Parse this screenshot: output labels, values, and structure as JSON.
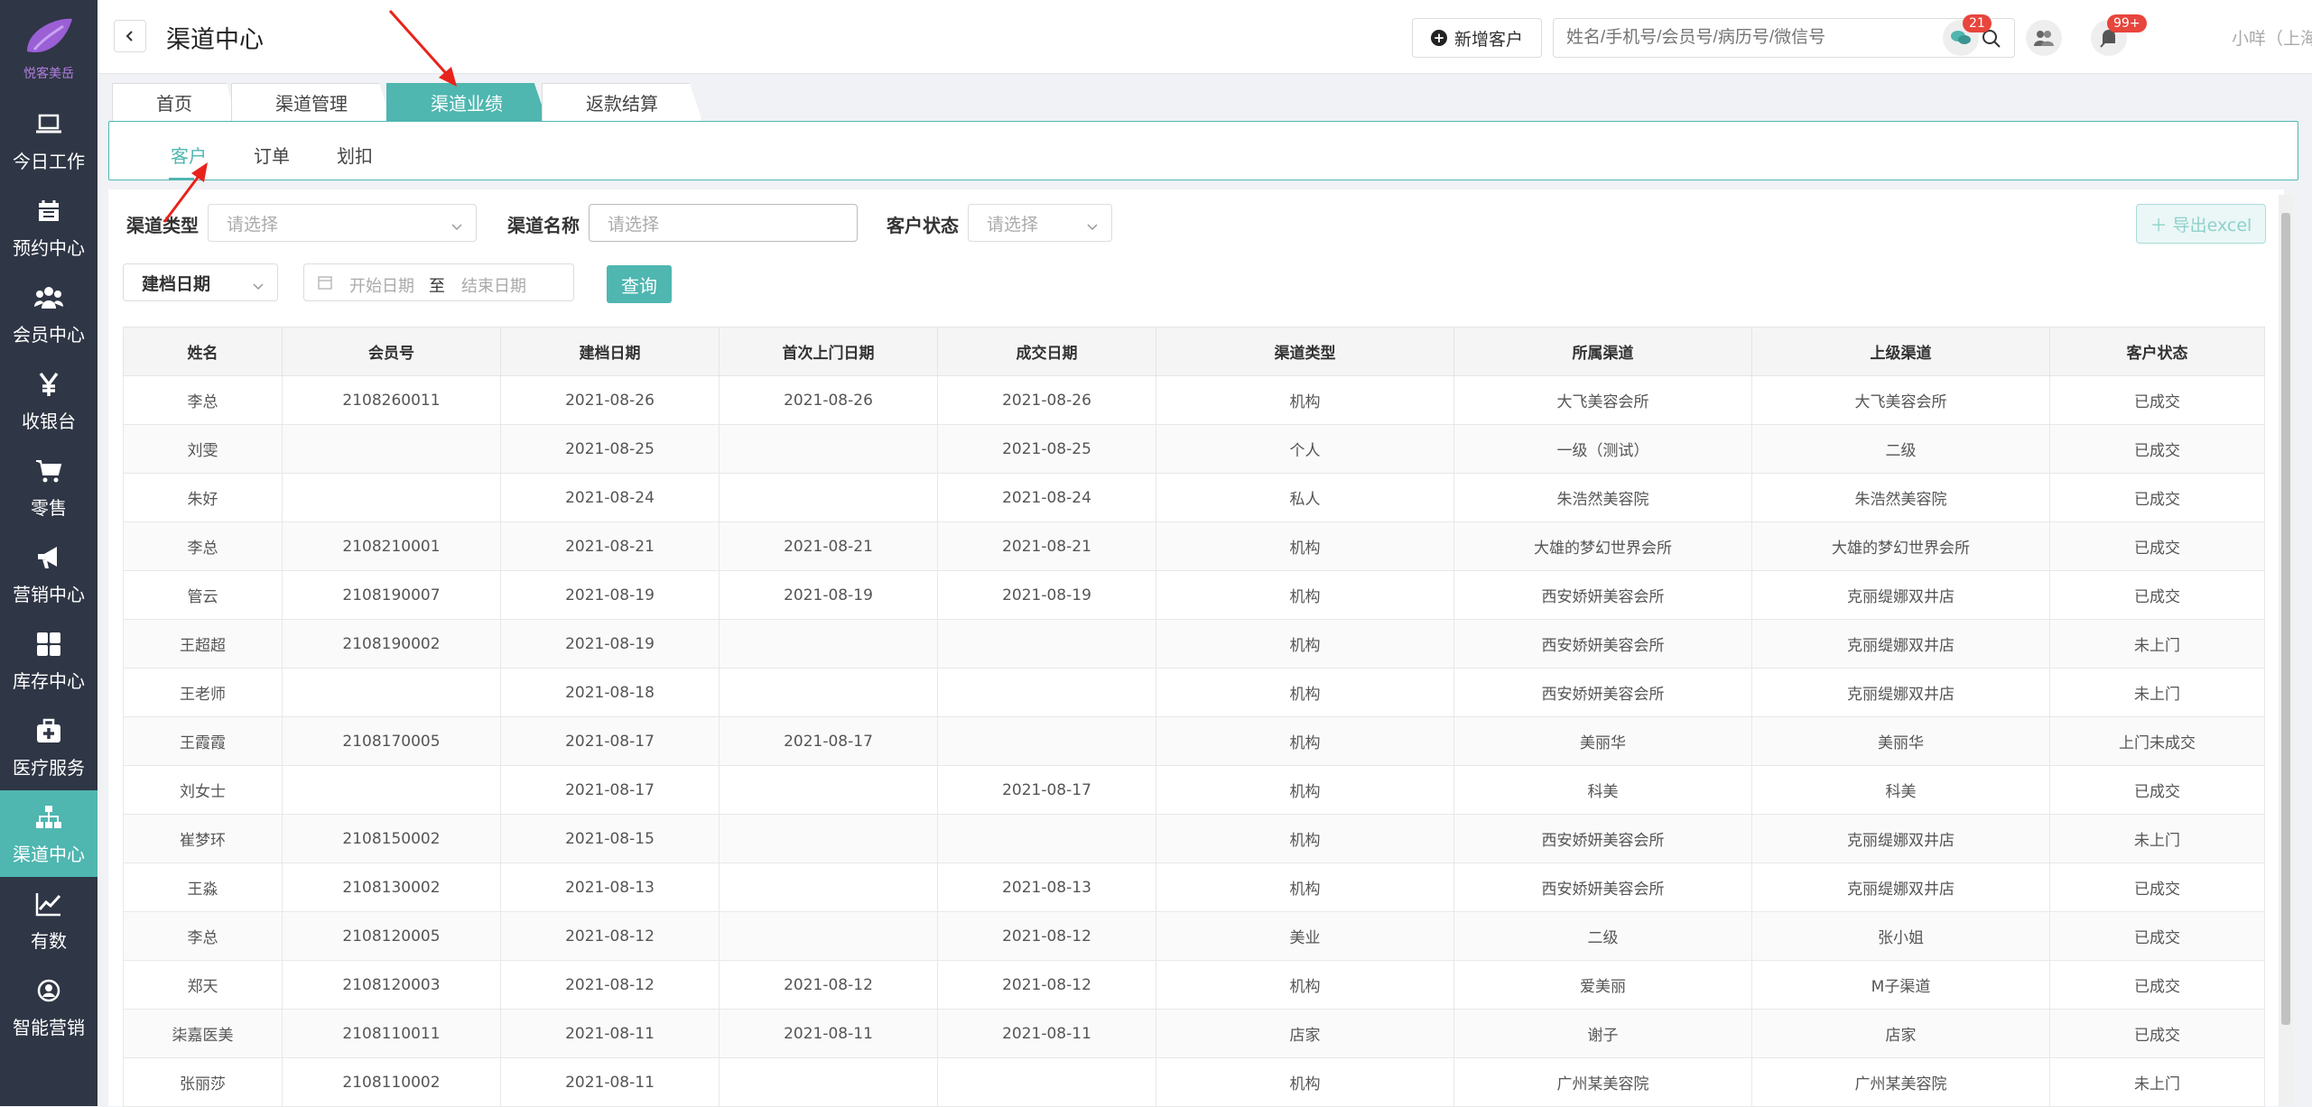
{
  "app": {
    "logo_text": "悦客美岳"
  },
  "sidebar": {
    "items": [
      {
        "label": "今日工作",
        "icon": "laptop-icon"
      },
      {
        "label": "预约中心",
        "icon": "calendar-icon"
      },
      {
        "label": "会员中心",
        "icon": "users-icon"
      },
      {
        "label": "收银台",
        "icon": "yen-icon"
      },
      {
        "label": "零售",
        "icon": "cart-icon"
      },
      {
        "label": "营销中心",
        "icon": "megaphone-icon"
      },
      {
        "label": "库存中心",
        "icon": "grid-icon"
      },
      {
        "label": "医疗服务",
        "icon": "medkit-icon"
      },
      {
        "label": "渠道中心",
        "icon": "sitemap-icon",
        "active": true
      },
      {
        "label": "有数",
        "icon": "line-chart-icon"
      },
      {
        "label": "智能营销",
        "icon": "smart-icon"
      }
    ]
  },
  "header": {
    "title": "渠道中心",
    "add_customer": "新增客户",
    "search_placeholder": "姓名/手机号/会员号/病历号/微信号",
    "chat_badge": "21",
    "notify_badge": "99+",
    "user": "小咩（上海张江门诊）"
  },
  "top_tabs": [
    "首页",
    "渠道管理",
    "渠道业绩",
    "返款结算"
  ],
  "sub_tabs": [
    "客户",
    "订单",
    "划扣"
  ],
  "filters": {
    "channel_type_label": "渠道类型",
    "channel_type_placeholder": "请选择",
    "channel_name_label": "渠道名称",
    "channel_name_placeholder": "请选择",
    "customer_status_label": "客户状态",
    "customer_status_placeholder": "请选择",
    "date_type": "建档日期",
    "start_placeholder": "开始日期",
    "to_label": "至",
    "end_placeholder": "结束日期",
    "query": "查询",
    "export": "导出excel"
  },
  "table": {
    "headers": [
      "姓名",
      "会员号",
      "建档日期",
      "首次上门日期",
      "成交日期",
      "渠道类型",
      "所属渠道",
      "上级渠道",
      "客户状态"
    ],
    "rows": [
      [
        "李总",
        "2108260011",
        "2021-08-26",
        "2021-08-26",
        "2021-08-26",
        "机构",
        "大飞美容会所",
        "大飞美容会所",
        "已成交"
      ],
      [
        "刘雯",
        "",
        "2021-08-25",
        "",
        "2021-08-25",
        "个人",
        "一级（测试）",
        "二级",
        "已成交"
      ],
      [
        "朱好",
        "",
        "2021-08-24",
        "",
        "2021-08-24",
        "私人",
        "朱浩然美容院",
        "朱浩然美容院",
        "已成交"
      ],
      [
        "李总",
        "2108210001",
        "2021-08-21",
        "2021-08-21",
        "2021-08-21",
        "机构",
        "大雄的梦幻世界会所",
        "大雄的梦幻世界会所",
        "已成交"
      ],
      [
        "管云",
        "2108190007",
        "2021-08-19",
        "2021-08-19",
        "2021-08-19",
        "机构",
        "西安娇妍美容会所",
        "克丽缇娜双井店",
        "已成交"
      ],
      [
        "王超超",
        "2108190002",
        "2021-08-19",
        "",
        "",
        "机构",
        "西安娇妍美容会所",
        "克丽缇娜双井店",
        "未上门"
      ],
      [
        "王老师",
        "",
        "2021-08-18",
        "",
        "",
        "机构",
        "西安娇妍美容会所",
        "克丽缇娜双井店",
        "未上门"
      ],
      [
        "王霞霞",
        "2108170005",
        "2021-08-17",
        "2021-08-17",
        "",
        "机构",
        "美丽华",
        "美丽华",
        "上门未成交"
      ],
      [
        "刘女士",
        "",
        "2021-08-17",
        "",
        "2021-08-17",
        "机构",
        "科美",
        "科美",
        "已成交"
      ],
      [
        "崔梦环",
        "2108150002",
        "2021-08-15",
        "",
        "",
        "机构",
        "西安娇妍美容会所",
        "克丽缇娜双井店",
        "未上门"
      ],
      [
        "王淼",
        "2108130002",
        "2021-08-13",
        "",
        "2021-08-13",
        "机构",
        "西安娇妍美容会所",
        "克丽缇娜双井店",
        "已成交"
      ],
      [
        "李总",
        "2108120005",
        "2021-08-12",
        "",
        "2021-08-12",
        "美业",
        "二级",
        "张小姐",
        "已成交"
      ],
      [
        "郑天",
        "2108120003",
        "2021-08-12",
        "2021-08-12",
        "2021-08-12",
        "机构",
        "爱美丽",
        "M子渠道",
        "已成交"
      ],
      [
        "柒嘉医美",
        "2108110011",
        "2021-08-11",
        "2021-08-11",
        "2021-08-11",
        "店家",
        "谢子",
        "店家",
        "已成交"
      ],
      [
        "张丽莎",
        "2108110002",
        "2021-08-11",
        "",
        "",
        "机构",
        "广州某美容院",
        "广州某美容院",
        "未上门"
      ]
    ]
  },
  "colors": {
    "accent": "#4fb6b0",
    "sidebar": "#2f3645",
    "badge": "#e8453c",
    "arrow": "#e8231b"
  }
}
